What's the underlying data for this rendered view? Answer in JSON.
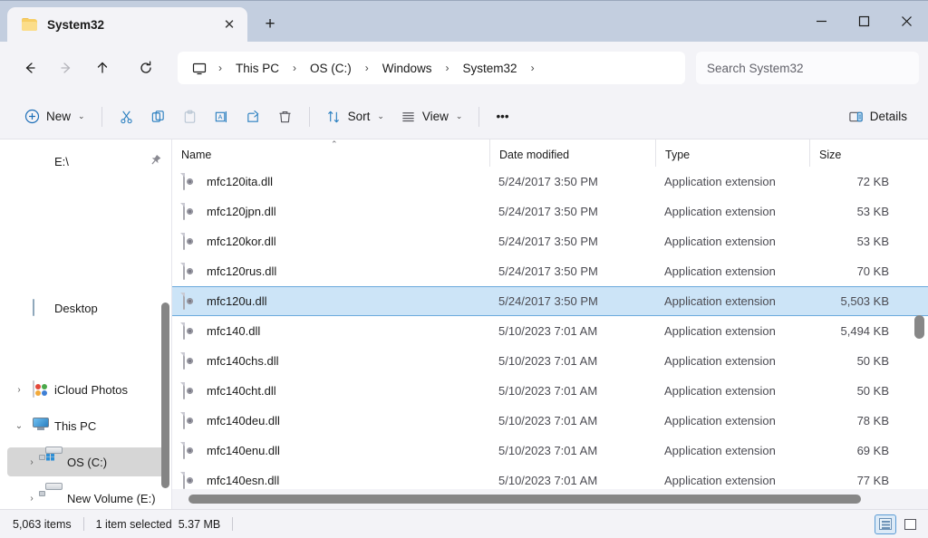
{
  "window": {
    "tab_title": "System32",
    "tab_close_label": "✕",
    "new_tab_label": "+",
    "minimize_label": "minimize",
    "maximize_label": "maximize",
    "close_label": "close",
    "titlebar_color": "#c3cedf"
  },
  "nav": {
    "back_label": "←",
    "forward_label": "→",
    "up_label": "↑",
    "refresh_label": "↻",
    "breadcrumbs": [
      {
        "label": "This PC"
      },
      {
        "label": "OS (C:)"
      },
      {
        "label": "Windows"
      },
      {
        "label": "System32"
      }
    ],
    "separator": "›"
  },
  "search": {
    "placeholder": "Search System32"
  },
  "toolbar": {
    "new_label": "New",
    "cut_label": "Cut",
    "copy_label": "Copy",
    "paste_label": "Paste",
    "rename_label": "Rename",
    "share_label": "Share",
    "delete_label": "Delete",
    "sort_label": "Sort",
    "view_label": "View",
    "more_label": "•••",
    "details_label": "Details",
    "chevron": "⌄"
  },
  "sidebar": {
    "items": [
      {
        "label": "E:\\",
        "icon": "media-drive-icon",
        "expander": "",
        "pinned": true,
        "selected": false
      },
      {
        "label": "Desktop",
        "icon": "desktop-icon",
        "expander": "",
        "pinned": false,
        "selected": false
      },
      {
        "label": "iCloud Photos",
        "icon": "icloud-photos-icon",
        "expander": "›",
        "pinned": false,
        "selected": false
      },
      {
        "label": "This PC",
        "icon": "this-pc-icon",
        "expander": "⌄",
        "pinned": false,
        "selected": false
      },
      {
        "label": "OS (C:)",
        "icon": "windows-drive-icon",
        "expander": "›",
        "pinned": false,
        "selected": true
      },
      {
        "label": "New Volume (E:)",
        "icon": "drive-icon",
        "expander": "›",
        "pinned": false,
        "selected": false
      }
    ]
  },
  "columns": {
    "name": "Name",
    "date_modified": "Date modified",
    "type": "Type",
    "size": "Size",
    "sort_caret": "⌃"
  },
  "files": [
    {
      "name": "mfc120ita.dll",
      "date": "5/24/2017 3:50 PM",
      "type": "Application extension",
      "size": "72 KB",
      "selected": false
    },
    {
      "name": "mfc120jpn.dll",
      "date": "5/24/2017 3:50 PM",
      "type": "Application extension",
      "size": "53 KB",
      "selected": false
    },
    {
      "name": "mfc120kor.dll",
      "date": "5/24/2017 3:50 PM",
      "type": "Application extension",
      "size": "53 KB",
      "selected": false
    },
    {
      "name": "mfc120rus.dll",
      "date": "5/24/2017 3:50 PM",
      "type": "Application extension",
      "size": "70 KB",
      "selected": false
    },
    {
      "name": "mfc120u.dll",
      "date": "5/24/2017 3:50 PM",
      "type": "Application extension",
      "size": "5,503 KB",
      "selected": true
    },
    {
      "name": "mfc140.dll",
      "date": "5/10/2023 7:01 AM",
      "type": "Application extension",
      "size": "5,494 KB",
      "selected": false
    },
    {
      "name": "mfc140chs.dll",
      "date": "5/10/2023 7:01 AM",
      "type": "Application extension",
      "size": "50 KB",
      "selected": false
    },
    {
      "name": "mfc140cht.dll",
      "date": "5/10/2023 7:01 AM",
      "type": "Application extension",
      "size": "50 KB",
      "selected": false
    },
    {
      "name": "mfc140deu.dll",
      "date": "5/10/2023 7:01 AM",
      "type": "Application extension",
      "size": "78 KB",
      "selected": false
    },
    {
      "name": "mfc140enu.dll",
      "date": "5/10/2023 7:01 AM",
      "type": "Application extension",
      "size": "69 KB",
      "selected": false
    },
    {
      "name": "mfc140esn.dll",
      "date": "5/10/2023 7:01 AM",
      "type": "Application extension",
      "size": "77 KB",
      "selected": false
    }
  ],
  "status": {
    "item_count": "5,063 items",
    "selection": "1 item selected",
    "selection_size": "5.37 MB",
    "details_view_label": "Details view",
    "icons_view_label": "Large icons view"
  },
  "colors": {
    "selection_blue": "#cce4f7",
    "selection_border": "#6aa9dc",
    "accent": "#2d8fd6",
    "chrome": "#f3f3f7"
  }
}
